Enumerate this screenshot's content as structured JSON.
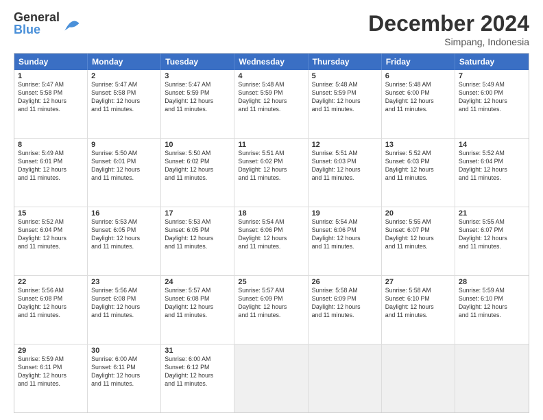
{
  "logo": {
    "general": "General",
    "blue": "Blue"
  },
  "title": "December 2024",
  "subtitle": "Simpang, Indonesia",
  "days_of_week": [
    "Sunday",
    "Monday",
    "Tuesday",
    "Wednesday",
    "Thursday",
    "Friday",
    "Saturday"
  ],
  "weeks": [
    [
      {
        "day": 1,
        "info": "Sunrise: 5:47 AM\nSunset: 5:58 PM\nDaylight: 12 hours\nand 11 minutes."
      },
      {
        "day": 2,
        "info": "Sunrise: 5:47 AM\nSunset: 5:58 PM\nDaylight: 12 hours\nand 11 minutes."
      },
      {
        "day": 3,
        "info": "Sunrise: 5:47 AM\nSunset: 5:59 PM\nDaylight: 12 hours\nand 11 minutes."
      },
      {
        "day": 4,
        "info": "Sunrise: 5:48 AM\nSunset: 5:59 PM\nDaylight: 12 hours\nand 11 minutes."
      },
      {
        "day": 5,
        "info": "Sunrise: 5:48 AM\nSunset: 5:59 PM\nDaylight: 12 hours\nand 11 minutes."
      },
      {
        "day": 6,
        "info": "Sunrise: 5:48 AM\nSunset: 6:00 PM\nDaylight: 12 hours\nand 11 minutes."
      },
      {
        "day": 7,
        "info": "Sunrise: 5:49 AM\nSunset: 6:00 PM\nDaylight: 12 hours\nand 11 minutes."
      }
    ],
    [
      {
        "day": 8,
        "info": "Sunrise: 5:49 AM\nSunset: 6:01 PM\nDaylight: 12 hours\nand 11 minutes."
      },
      {
        "day": 9,
        "info": "Sunrise: 5:50 AM\nSunset: 6:01 PM\nDaylight: 12 hours\nand 11 minutes."
      },
      {
        "day": 10,
        "info": "Sunrise: 5:50 AM\nSunset: 6:02 PM\nDaylight: 12 hours\nand 11 minutes."
      },
      {
        "day": 11,
        "info": "Sunrise: 5:51 AM\nSunset: 6:02 PM\nDaylight: 12 hours\nand 11 minutes."
      },
      {
        "day": 12,
        "info": "Sunrise: 5:51 AM\nSunset: 6:03 PM\nDaylight: 12 hours\nand 11 minutes."
      },
      {
        "day": 13,
        "info": "Sunrise: 5:52 AM\nSunset: 6:03 PM\nDaylight: 12 hours\nand 11 minutes."
      },
      {
        "day": 14,
        "info": "Sunrise: 5:52 AM\nSunset: 6:04 PM\nDaylight: 12 hours\nand 11 minutes."
      }
    ],
    [
      {
        "day": 15,
        "info": "Sunrise: 5:52 AM\nSunset: 6:04 PM\nDaylight: 12 hours\nand 11 minutes."
      },
      {
        "day": 16,
        "info": "Sunrise: 5:53 AM\nSunset: 6:05 PM\nDaylight: 12 hours\nand 11 minutes."
      },
      {
        "day": 17,
        "info": "Sunrise: 5:53 AM\nSunset: 6:05 PM\nDaylight: 12 hours\nand 11 minutes."
      },
      {
        "day": 18,
        "info": "Sunrise: 5:54 AM\nSunset: 6:06 PM\nDaylight: 12 hours\nand 11 minutes."
      },
      {
        "day": 19,
        "info": "Sunrise: 5:54 AM\nSunset: 6:06 PM\nDaylight: 12 hours\nand 11 minutes."
      },
      {
        "day": 20,
        "info": "Sunrise: 5:55 AM\nSunset: 6:07 PM\nDaylight: 12 hours\nand 11 minutes."
      },
      {
        "day": 21,
        "info": "Sunrise: 5:55 AM\nSunset: 6:07 PM\nDaylight: 12 hours\nand 11 minutes."
      }
    ],
    [
      {
        "day": 22,
        "info": "Sunrise: 5:56 AM\nSunset: 6:08 PM\nDaylight: 12 hours\nand 11 minutes."
      },
      {
        "day": 23,
        "info": "Sunrise: 5:56 AM\nSunset: 6:08 PM\nDaylight: 12 hours\nand 11 minutes."
      },
      {
        "day": 24,
        "info": "Sunrise: 5:57 AM\nSunset: 6:08 PM\nDaylight: 12 hours\nand 11 minutes."
      },
      {
        "day": 25,
        "info": "Sunrise: 5:57 AM\nSunset: 6:09 PM\nDaylight: 12 hours\nand 11 minutes."
      },
      {
        "day": 26,
        "info": "Sunrise: 5:58 AM\nSunset: 6:09 PM\nDaylight: 12 hours\nand 11 minutes."
      },
      {
        "day": 27,
        "info": "Sunrise: 5:58 AM\nSunset: 6:10 PM\nDaylight: 12 hours\nand 11 minutes."
      },
      {
        "day": 28,
        "info": "Sunrise: 5:59 AM\nSunset: 6:10 PM\nDaylight: 12 hours\nand 11 minutes."
      }
    ],
    [
      {
        "day": 29,
        "info": "Sunrise: 5:59 AM\nSunset: 6:11 PM\nDaylight: 12 hours\nand 11 minutes."
      },
      {
        "day": 30,
        "info": "Sunrise: 6:00 AM\nSunset: 6:11 PM\nDaylight: 12 hours\nand 11 minutes."
      },
      {
        "day": 31,
        "info": "Sunrise: 6:00 AM\nSunset: 6:12 PM\nDaylight: 12 hours\nand 11 minutes."
      },
      null,
      null,
      null,
      null
    ]
  ]
}
